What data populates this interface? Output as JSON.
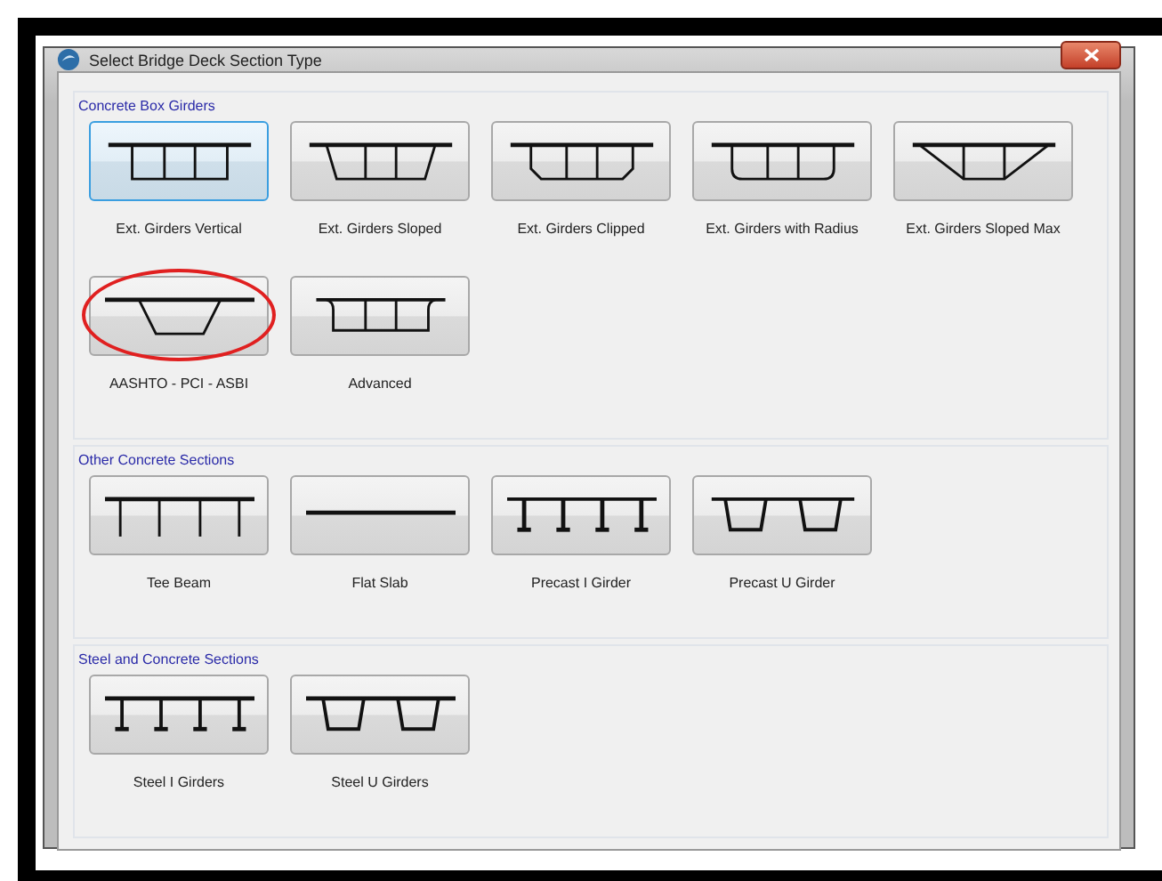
{
  "window": {
    "title": "Select Bridge Deck Section Type"
  },
  "sections": [
    {
      "title": "Concrete Box Girders",
      "items": [
        {
          "label": "Ext. Girders Vertical",
          "kind": "vertical",
          "selected": true,
          "circled": false
        },
        {
          "label": "Ext. Girders Sloped",
          "kind": "sloped",
          "selected": false,
          "circled": false
        },
        {
          "label": "Ext. Girders Clipped",
          "kind": "clipped",
          "selected": false,
          "circled": false
        },
        {
          "label": "Ext. Girders with Radius",
          "kind": "radius",
          "selected": false,
          "circled": false
        },
        {
          "label": "Ext. Girders Sloped Max",
          "kind": "slopedmax",
          "selected": false,
          "circled": false
        },
        {
          "label": "AASHTO - PCI - ASBI",
          "kind": "aashto",
          "selected": false,
          "circled": true
        },
        {
          "label": "Advanced",
          "kind": "advanced",
          "selected": false,
          "circled": false
        }
      ]
    },
    {
      "title": "Other Concrete Sections",
      "items": [
        {
          "label": "Tee Beam",
          "kind": "tee",
          "selected": false,
          "circled": false
        },
        {
          "label": "Flat Slab",
          "kind": "flat",
          "selected": false,
          "circled": false
        },
        {
          "label": "Precast I Girder",
          "kind": "precasti",
          "selected": false,
          "circled": false
        },
        {
          "label": "Precast U Girder",
          "kind": "precastu",
          "selected": false,
          "circled": false
        }
      ]
    },
    {
      "title": "Steel and Concrete Sections",
      "items": [
        {
          "label": "Steel I Girders",
          "kind": "steeli",
          "selected": false,
          "circled": false
        },
        {
          "label": "Steel U Girders",
          "kind": "steelu",
          "selected": false,
          "circled": false
        }
      ]
    }
  ]
}
